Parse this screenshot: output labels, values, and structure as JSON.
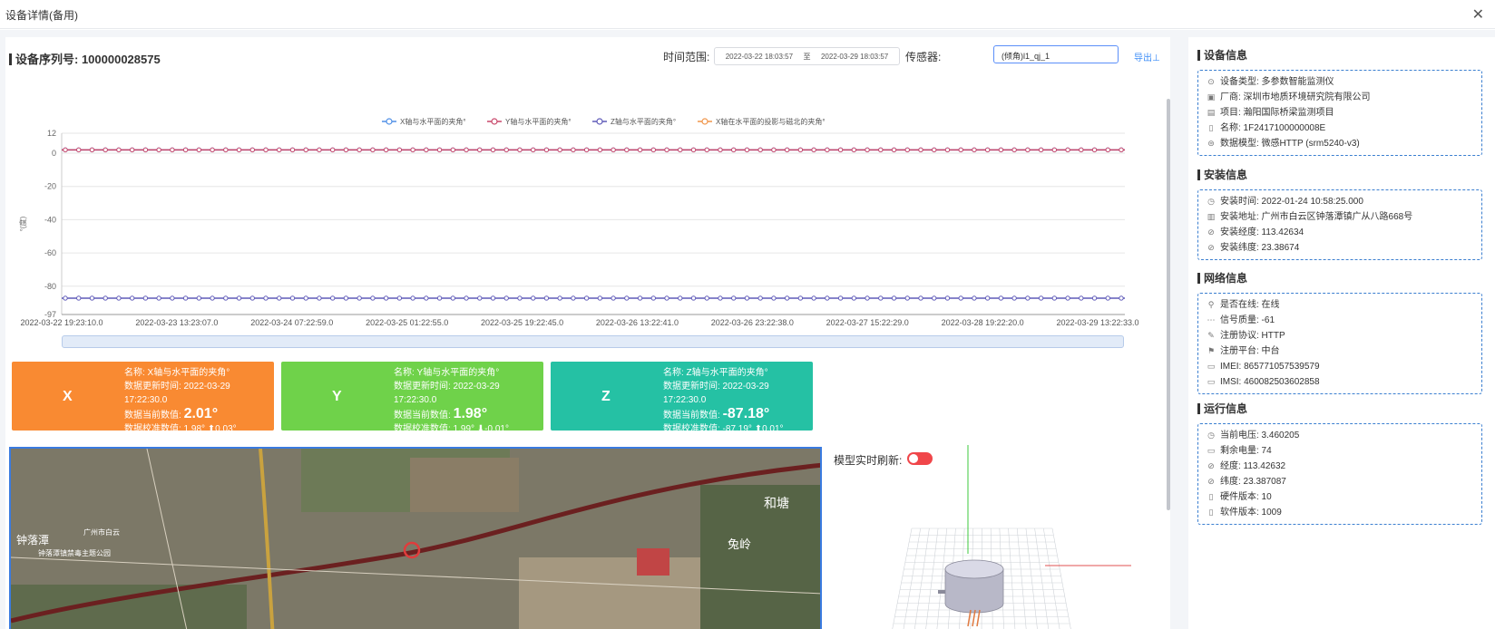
{
  "window": {
    "title": "设备详情(备用)",
    "close_icon": "✕"
  },
  "header": {
    "serial_label": "设备序列号: 100000028575",
    "time_range_label": "时间范围:",
    "start_time": "2022-03-22 18:03:57",
    "to_label": "至",
    "end_time": "2022-03-29 18:03:57",
    "sensor_label": "传感器:",
    "sensor_value": "(倾角)l1_qj_1",
    "export_label": "导出⊥"
  },
  "chart_data": {
    "type": "line",
    "ylabel": "°(度)",
    "ylim": [
      -97,
      12
    ],
    "yticks": [
      12,
      0,
      -20,
      -40,
      -60,
      -80,
      -97
    ],
    "x_tick_labels": [
      "2022-03-22 19:23:10.0",
      "2022-03-23 13:23:07.0",
      "2022-03-24 07:22:59.0",
      "2022-03-25 01:22:55.0",
      "2022-03-25 19:22:45.0",
      "2022-03-26 13:22:41.0",
      "2022-03-26 23:22:38.0",
      "2022-03-27 15:22:29.0",
      "2022-03-28 19:22:20.0",
      "2022-03-29 13:22:33.0"
    ],
    "point_count": 80,
    "series": [
      {
        "name": "X轴与水平面的夹角°",
        "color": "#4f8fe6",
        "value": 2.01
      },
      {
        "name": "Y轴与水平面的夹角°",
        "color": "#c8476a",
        "value": 1.98
      },
      {
        "name": "Z轴与水平面的夹角°",
        "color": "#5f5ab8",
        "value": -87.18
      },
      {
        "name": "X轴在水平面的投影与磁北的夹角°",
        "color": "#f0954a",
        "value": null
      }
    ],
    "grid": true,
    "legend": "top-center"
  },
  "cards": [
    {
      "letter": "X",
      "color": "#f98a32",
      "name": "名称: X轴与水平面的夹角°",
      "update": "数据更新时间: 2022-03-29 17:22:30.0",
      "current_label": "数据当前数值:",
      "current_value": "2.01°",
      "calib": "数据校准数值: 1.98° ⬆0.03°"
    },
    {
      "letter": "Y",
      "color": "#6fd24a",
      "name": "名称: Y轴与水平面的夹角°",
      "update": "数据更新时间: 2022-03-29 17:22:30.0",
      "current_label": "数据当前数值:",
      "current_value": "1.98°",
      "calib": "数据校准数值: 1.99° ⬇-0.01°"
    },
    {
      "letter": "Z",
      "color": "#25c1a4",
      "name": "名称: Z轴与水平面的夹角°",
      "update": "数据更新时间: 2022-03-29 17:22:30.0",
      "current_label": "数据当前数值:",
      "current_value": "-87.18°",
      "calib": "数据校准数值: -87.19° ⬆0.01°"
    }
  ],
  "map": {
    "labels": [
      "钟落潭",
      "钟落潭镇禁毒主题公园",
      "和塘",
      "兔岭",
      "广州市白云"
    ]
  },
  "model": {
    "refresh_label": "模型实时刷新:"
  },
  "sidebar": {
    "device": {
      "title": "设备信息",
      "rows": [
        {
          "icon": "⊙",
          "text": "设备类型: 多参数智能监测仪"
        },
        {
          "icon": "▣",
          "text": "厂商: 深圳市地质环境研究院有限公司"
        },
        {
          "icon": "▤",
          "text": "项目: 瀚阳国际桥梁监测项目"
        },
        {
          "icon": "▯",
          "text": "名称: 1F2417100000008E"
        },
        {
          "icon": "⊜",
          "text": "数据模型: 微感HTTP (srm5240-v3)"
        }
      ]
    },
    "install": {
      "title": "安装信息",
      "rows": [
        {
          "icon": "◷",
          "text": "安装时间: 2022-01-24 10:58:25.000"
        },
        {
          "icon": "▥",
          "text": "安装地址: 广州市白云区钟落潭镇广从八路668号"
        },
        {
          "icon": "⊘",
          "text": "安装经度: 113.42634"
        },
        {
          "icon": "⊘",
          "text": "安装纬度: 23.38674"
        }
      ]
    },
    "network": {
      "title": "网络信息",
      "rows": [
        {
          "icon": "⚲",
          "text": "是否在线: 在线"
        },
        {
          "icon": "⋯",
          "text": "信号质量: -61"
        },
        {
          "icon": "✎",
          "text": "注册协议: HTTP"
        },
        {
          "icon": "⚑",
          "text": "注册平台: 中台"
        },
        {
          "icon": "▭",
          "text": "IMEI: 865771057539579"
        },
        {
          "icon": "▭",
          "text": "IMSI: 460082503602858"
        }
      ]
    },
    "runtime": {
      "title": "运行信息",
      "rows": [
        {
          "icon": "◷",
          "text": "当前电压: 3.460205"
        },
        {
          "icon": "▭",
          "text": "剩余电量: 74"
        },
        {
          "icon": "⊘",
          "text": "经度: 113.42632"
        },
        {
          "icon": "⊘",
          "text": "纬度: 23.387087"
        },
        {
          "icon": "▯",
          "text": "硬件版本: 10"
        },
        {
          "icon": "▯",
          "text": "软件版本: 1009"
        }
      ]
    }
  }
}
